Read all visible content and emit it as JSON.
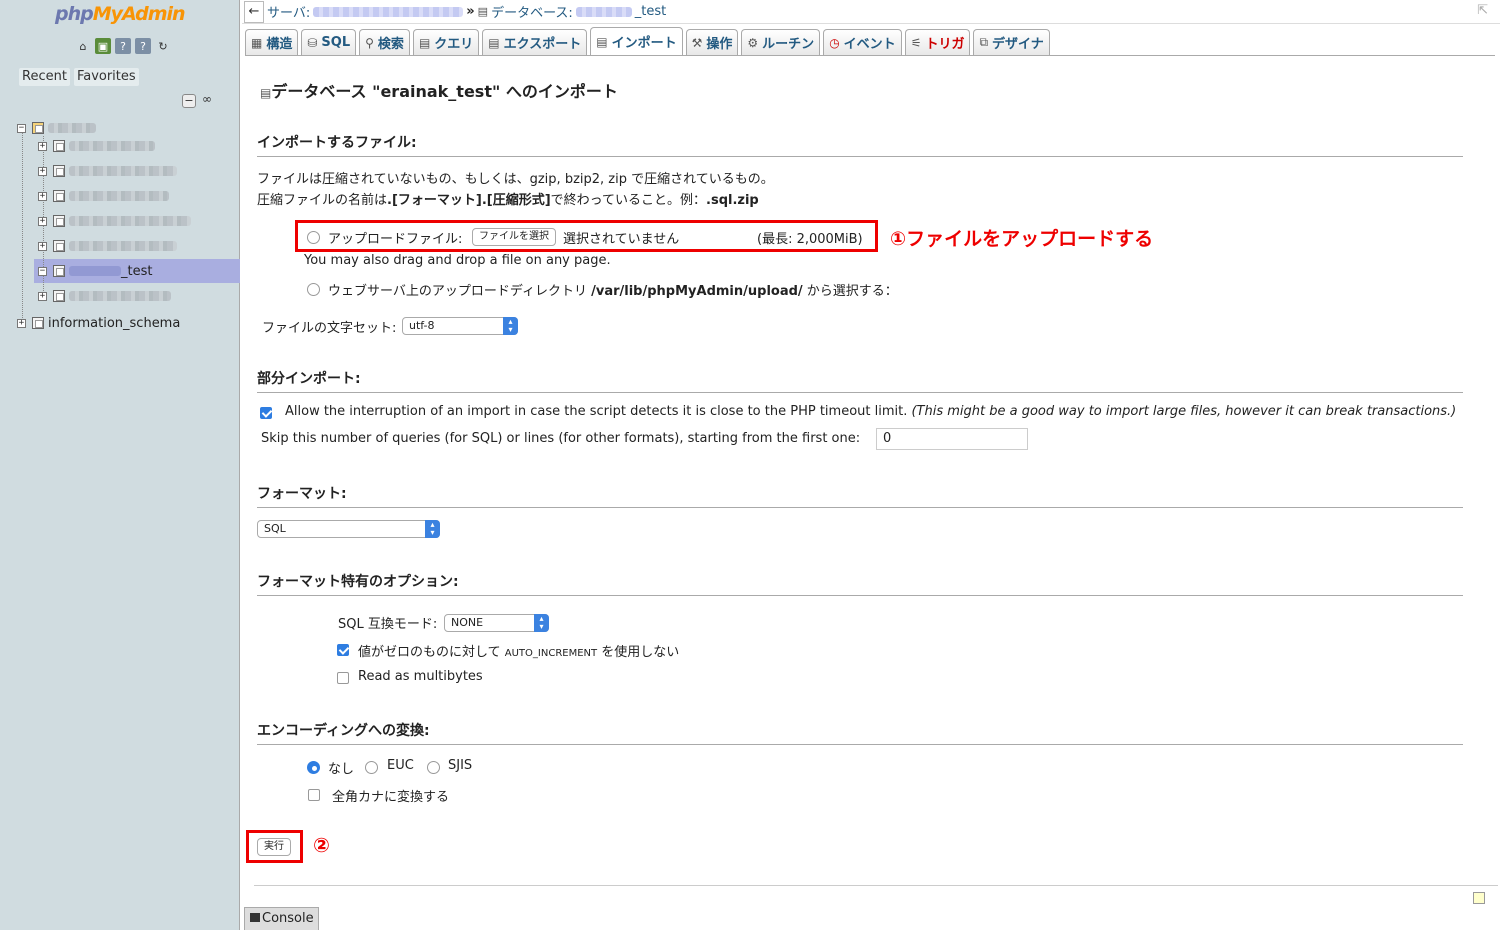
{
  "nav": {
    "logo_php": "php",
    "logo_myadmin": "MyAdmin",
    "icons": [
      "home-icon",
      "exit-icon",
      "docs-icon",
      "sql-docs-icon",
      "reload-icon"
    ],
    "recent_label": "Recent",
    "favorites_label": "Favorites",
    "collapse_label": "−",
    "link_label": "∞",
    "tree": {
      "selected_db_suffix": "_test",
      "info_schema": "information_schema"
    }
  },
  "topbar": {
    "back": "←",
    "server_label": "サーバ:",
    "sep": "»",
    "database_label": "データベース:",
    "database_suffix": "_test",
    "close": "⇱"
  },
  "tabs": [
    {
      "label": "構造",
      "icon": "structure-icon"
    },
    {
      "label": "SQL",
      "icon": "sql-icon"
    },
    {
      "label": "検索",
      "icon": "search-icon"
    },
    {
      "label": "クエリ",
      "icon": "query-icon"
    },
    {
      "label": "エクスポート",
      "icon": "export-icon"
    },
    {
      "label": "インポート",
      "icon": "import-icon",
      "active": true
    },
    {
      "label": "操作",
      "icon": "operations-icon"
    },
    {
      "label": "ルーチン",
      "icon": "routines-icon"
    },
    {
      "label": "イベント",
      "icon": "events-icon"
    },
    {
      "label": "トリガ",
      "icon": "triggers-icon"
    },
    {
      "label": "デザイナ",
      "icon": "designer-icon"
    }
  ],
  "page": {
    "title": "データベース \"erainak_test\" へのインポート",
    "file_section": "インポートするファイル:",
    "file_desc1": "ファイルは圧縮されていないもの、もしくは、gzip, bzip2, zip で圧縮されているもの。",
    "file_desc2_a": "圧縮ファイルの名前は",
    "file_desc2_b": ".[フォーマット].[圧縮形式]",
    "file_desc2_c": "で終わっていること。例：",
    "file_desc2_d": ".sql.zip",
    "upload_label": "アップロードファイル:",
    "choose_file_button": "ファイルを選択",
    "no_file_selected": "選択されていません",
    "max_size": "(最長: 2,000MiB)",
    "drag_drop": "You may also drag and drop a file on any page.",
    "webserver_a": "ウェブサーバ上のアップロードディレクトリ",
    "webserver_b": "/var/lib/phpMyAdmin/upload/",
    "webserver_c": "から選択する：",
    "charset_label": "ファイルの文字セット:",
    "charset_value": "utf-8",
    "partial_section": "部分インポート:",
    "allow_interrupt": "Allow the interruption of an import in case the script detects it is close to the PHP timeout limit.",
    "allow_interrupt_note": "(This might be a good way to import large files, however it can break transactions.)",
    "skip_label": "Skip this number of queries (for SQL) or lines (for other formats), starting from the first one:",
    "skip_value": "0",
    "format_section": "フォーマット:",
    "format_value": "SQL",
    "format_options_section": "フォーマット特有のオプション:",
    "compat_label": "SQL 互換モード:",
    "compat_value": "NONE",
    "no_auto_increment_a": "値がゼロのものに対して",
    "no_auto_increment_b": "AUTO_INCREMENT",
    "no_auto_increment_c": "を使用しない",
    "read_multibytes": "Read as multibytes",
    "encoding_section": "エンコーディングへの変換:",
    "enc_none": "なし",
    "enc_euc": "EUC",
    "enc_sjis": "SJIS",
    "zenkaku_kana": "全角カナに変換する",
    "submit_button": "実行",
    "annotation_1": "①ファイルをアップロードする",
    "annotation_2": "②",
    "console_label": "Console"
  },
  "colors": {
    "nav_bg": "#d0dce0",
    "selected_bg": "#a9aee0",
    "link": "#235a81",
    "annotation": "#ee0000",
    "checkbox_on": "#2e7de1"
  }
}
